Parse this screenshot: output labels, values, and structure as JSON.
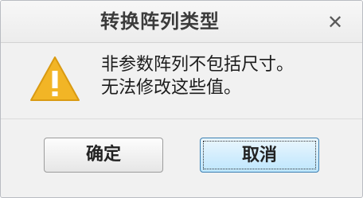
{
  "dialog": {
    "title": "转换阵列类型",
    "close_label": "✕",
    "message_line1": "非参数阵列不包括尺寸。",
    "message_line2": "无法修改这些值。",
    "icon": "warning-icon",
    "ok_label": "确定",
    "cancel_label": "取消"
  },
  "colors": {
    "warning_fill": "#f2b526",
    "focus_button_border": "#3c7fb1"
  }
}
